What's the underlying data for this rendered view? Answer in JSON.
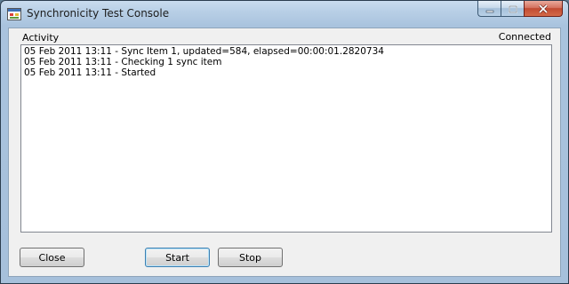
{
  "window": {
    "title": "Synchronicity Test Console"
  },
  "activity": {
    "label": "Activity",
    "status": "Connected",
    "log": [
      "05 Feb 2011 13:11 - Sync Item 1, updated=584, elapsed=00:00:01.2820734",
      "05 Feb 2011 13:11 - Checking 1 sync item",
      "05 Feb 2011 13:11 - Started"
    ]
  },
  "buttons": {
    "close_label": "Close",
    "start_label": "Start",
    "stop_label": "Stop"
  },
  "colors": {
    "frame": "#a9c3de",
    "close_caption": "#c14a32",
    "default_button_border": "#3c7fb1"
  },
  "icons": {
    "app": "app-window-icon",
    "minimize": "minimize-icon",
    "maximize": "maximize-icon",
    "close": "close-icon"
  }
}
